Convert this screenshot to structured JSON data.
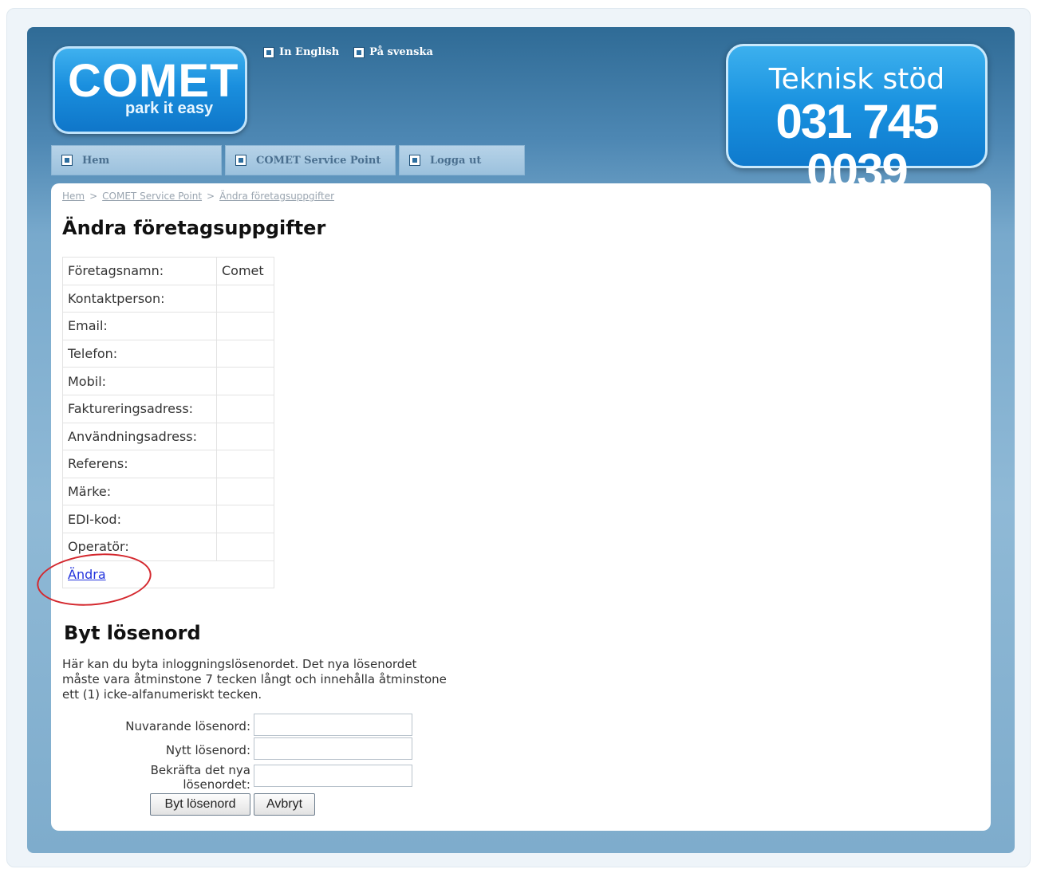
{
  "brand": {
    "logo_main": "COMET",
    "logo_tagline": "park it easy"
  },
  "language": {
    "english": "In English",
    "swedish": "På svenska"
  },
  "support": {
    "title": "Teknisk stöd",
    "phone": "031 745 0039"
  },
  "nav": [
    {
      "label": "Hem",
      "icon": "square-bullet-icon"
    },
    {
      "label": "COMET Service Point",
      "icon": "square-bullet-icon"
    },
    {
      "label": "Logga ut",
      "icon": "square-bullet-icon"
    }
  ],
  "breadcrumb": {
    "items": [
      "Hem",
      "COMET Service Point",
      "Ändra företagsuppgifter"
    ],
    "separator": ">"
  },
  "company": {
    "title": "Ändra företagsuppgifter",
    "fields": [
      {
        "label": "Företagsnamn:",
        "value": "Comet"
      },
      {
        "label": "Kontaktperson:",
        "value": ""
      },
      {
        "label": "Email:",
        "value": ""
      },
      {
        "label": "Telefon:",
        "value": ""
      },
      {
        "label": "Mobil:",
        "value": ""
      },
      {
        "label": "Faktureringsadress:",
        "value": ""
      },
      {
        "label": "Användningsadress:",
        "value": ""
      },
      {
        "label": "Referens:",
        "value": ""
      },
      {
        "label": "Märke:",
        "value": ""
      },
      {
        "label": "EDI-kod:",
        "value": ""
      },
      {
        "label": "Operatör:",
        "value": ""
      }
    ],
    "edit_link": "Ändra"
  },
  "password": {
    "title": "Byt lösenord",
    "description": "Här kan du byta inloggningslösenordet. Det nya lösenordet måste vara åtminstone 7 tecken långt och innehålla åtminstone ett (1) icke-alfanumeriskt tecken.",
    "current_label": "Nuvarande lösenord:",
    "new_label": "Nytt lösenord:",
    "confirm_label_line1": "Bekräfta det nya",
    "confirm_label_line2": "lösenordet:",
    "submit_label": "Byt lösenord",
    "cancel_label": "Avbryt"
  },
  "colors": {
    "header_blue": "#2f6b96",
    "logo_blue": "#1a8fde",
    "annotation_red": "#d4282e",
    "link_blue": "#2233dd"
  }
}
